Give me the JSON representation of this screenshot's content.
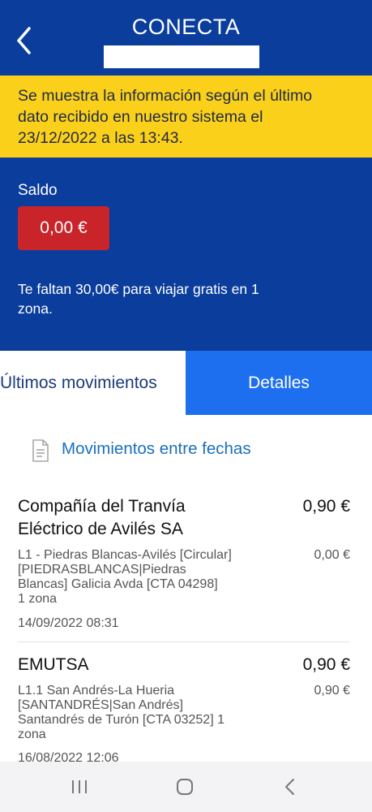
{
  "header": {
    "title": "CONECTA",
    "back_icon": "chevron-left-icon"
  },
  "banner": {
    "text_line1": "Se muestra la información según el último",
    "text_line2": "dato recibido en nuestro sistema el",
    "text_line3": "23/12/2022 a las 13:43."
  },
  "balance": {
    "label": "Saldo",
    "amount": "0,00 €",
    "message_line1": "Te faltan 30,00€ para viajar gratis en 1",
    "message_line2": "zona."
  },
  "tabs": [
    {
      "label": "Últimos movimientos",
      "active": false
    },
    {
      "label": "Detalles",
      "active": true
    }
  ],
  "movimientos_link": {
    "label": "Movimientos entre fechas",
    "icon": "document-icon"
  },
  "transactions": [
    {
      "title_line1": "Compañía del Tranvía",
      "title_line2": "Eléctrico de Avilés SA",
      "amount": "0,90 €",
      "detail_line1": "L1 - Piedras Blancas-Avilés [Circular]",
      "detail_line2": "[PIEDRASBLANCAS|Piedras",
      "detail_line3": "Blancas]  Galicia Avda [CTA 04298]",
      "detail_line4": "1 zona",
      "sub_amount": "0,00 €",
      "date": "14/09/2022 08:31"
    },
    {
      "title_line1": "EMUTSA",
      "amount": "0,90 €",
      "detail_line1": "L1.1 San Andrés-La Hueria",
      "detail_line2": "[SANTANDRÉS|San Andrés]",
      "detail_line3": "Santandrés de Turón [CTA 03252] 1",
      "detail_line4": "zona",
      "sub_amount": "0,90 €",
      "date": "16/08/2022 12:06"
    }
  ],
  "colors": {
    "brand_blue": "#0a3d9c",
    "banner_yellow": "#fbd01a",
    "balance_red": "#c8242a",
    "tab_active": "#1e6ff0",
    "link_blue": "#1a6fbf"
  },
  "system_nav": {
    "recent_icon": "recent-apps-icon",
    "home_icon": "home-icon",
    "back_icon": "back-icon"
  }
}
